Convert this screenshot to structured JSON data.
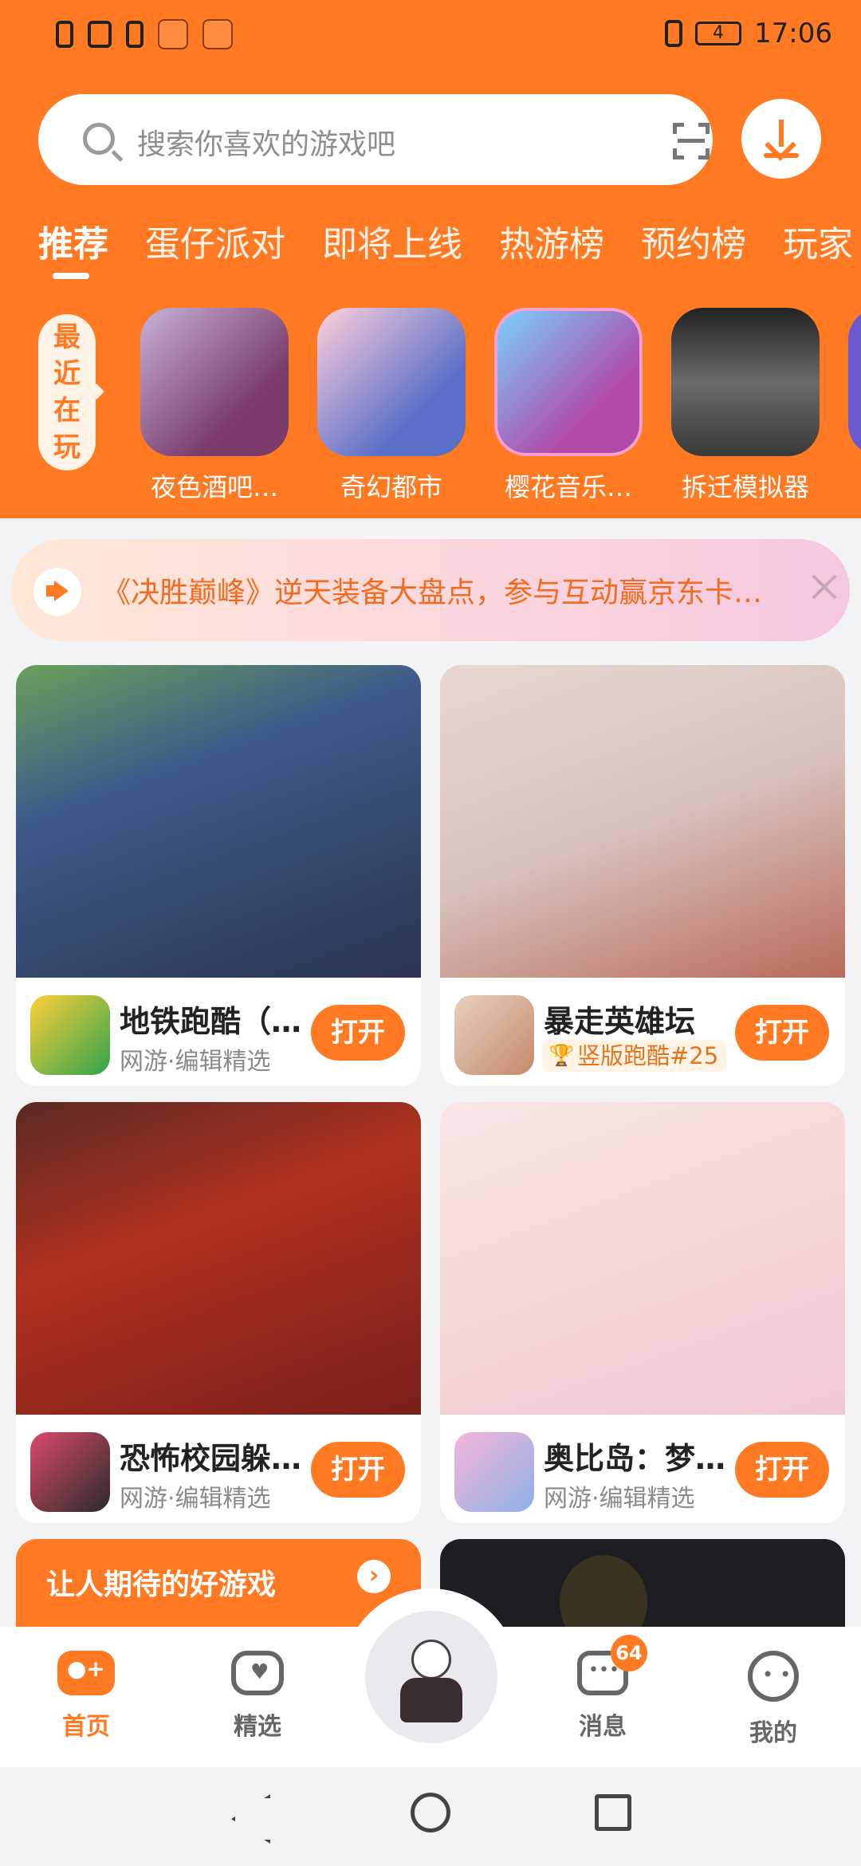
{
  "status_bar": {
    "time": "17:06",
    "battery": "4"
  },
  "search": {
    "placeholder": "搜索你喜欢的游戏吧"
  },
  "tabs": [
    {
      "label": "推荐",
      "active": true
    },
    {
      "label": "蛋仔派对"
    },
    {
      "label": "即将上线"
    },
    {
      "label": "热游榜"
    },
    {
      "label": "预约榜"
    },
    {
      "label": "玩家"
    }
  ],
  "recent": {
    "label": [
      "最",
      "近",
      "在",
      "玩"
    ],
    "items": [
      {
        "name": "夜色酒吧…",
        "color": "#7a3a6a"
      },
      {
        "name": "奇幻都市",
        "color": "#5a6fc8"
      },
      {
        "name": "樱花音乐…",
        "color": "#b04aa8"
      },
      {
        "name": "拆迁模拟器",
        "color": "#4a4a4a"
      },
      {
        "name": "",
        "color": "#6a5ad0"
      }
    ]
  },
  "notice": {
    "text": "《决胜巅峰》逆天装备大盘点，参与互动赢京东卡…"
  },
  "cards": [
    {
      "name": "地铁跑酷（…",
      "sub": "网游·编辑精选",
      "rank": "",
      "button": "打开",
      "img_color": "#3d5a8a",
      "icon_color": "#2fa34a"
    },
    {
      "name": "暴走英雄坛",
      "sub": "",
      "rank": "竖版跑酷#25",
      "button": "打开",
      "img_color": "#e9d6cf",
      "icon_color": "#c48a6a"
    },
    {
      "name": "恐怖校园躲…",
      "sub": "网游·编辑精选",
      "rank": "",
      "button": "打开",
      "img_color": "#7a1f1a",
      "icon_color": "#2a2a2a"
    },
    {
      "name": "奥比岛：梦…",
      "sub": "网游·编辑精选",
      "rank": "",
      "button": "打开",
      "img_color": "#f4d6d6",
      "icon_color": "#8fb0e8"
    }
  ],
  "promo": {
    "title": "让人期待的好游戏"
  },
  "bottom_nav": [
    {
      "label": "首页",
      "icon": "gamepad-icon",
      "active": true
    },
    {
      "label": "精选",
      "icon": "heart-icon"
    },
    {
      "label": "消息",
      "icon": "message-icon",
      "badge": "64"
    },
    {
      "label": "我的",
      "icon": "face-icon"
    }
  ],
  "colors": {
    "accent": "#ff7a22"
  }
}
